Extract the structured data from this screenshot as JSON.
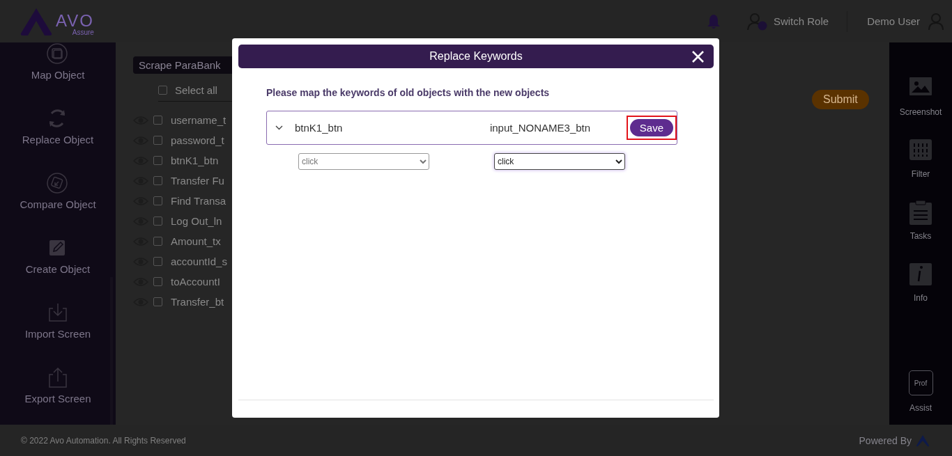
{
  "header": {
    "logo_text": "AVO",
    "logo_subtext": "Assure",
    "switch_role": "Switch Role",
    "user_name": "Demo User"
  },
  "left_sidebar": {
    "items": [
      {
        "label": "Map Object",
        "kind": "layers"
      },
      {
        "label": "Replace Object",
        "kind": "refresh"
      },
      {
        "label": "Compare Object",
        "kind": "compare"
      },
      {
        "label": "Create Object",
        "kind": "edit"
      },
      {
        "label": "Import Screen",
        "kind": "import"
      },
      {
        "label": "Export Screen",
        "kind": "export"
      }
    ]
  },
  "content": {
    "tab": "Scrape ParaBank",
    "select_all": {
      "label": "Select all",
      "checked": false
    },
    "submit": "Submit",
    "objects": [
      {
        "name": "username_t",
        "checked": false
      },
      {
        "name": "password_t",
        "checked": false
      },
      {
        "name": "btnK1_btn",
        "checked": false
      },
      {
        "name": "Transfer Fu",
        "checked": false
      },
      {
        "name": "Find Transa",
        "checked": false
      },
      {
        "name": "Log Out_ln",
        "checked": false
      },
      {
        "name": "Amount_tx",
        "checked": false
      },
      {
        "name": "accountId_s",
        "checked": false
      },
      {
        "name": "toAccountI",
        "checked": false
      },
      {
        "name": "Transfer_bt",
        "checked": false
      }
    ]
  },
  "right_sidebar": {
    "items": [
      {
        "label": "Screenshot",
        "kind": "image"
      },
      {
        "label": "Filter",
        "kind": "filter"
      },
      {
        "label": "Tasks",
        "kind": "clipboard"
      },
      {
        "label": "Info",
        "kind": "info"
      }
    ],
    "assist": {
      "badge": "Prof",
      "label": "Assist"
    }
  },
  "footer": {
    "copyright": "© 2022 Avo Automation. All Rights Reserved",
    "powered_by": "Powered By"
  },
  "modal": {
    "title": "Replace Keywords",
    "instruction": "Please map the keywords of old objects with the new objects",
    "mappings": [
      {
        "old_object": "btnK1_btn",
        "new_object": "input_NONAME3_btn",
        "save": "Save",
        "highlighted": true,
        "old_keyword": {
          "value": "click",
          "focused": false
        },
        "new_keyword": {
          "value": "click",
          "focused": true
        }
      }
    ]
  }
}
